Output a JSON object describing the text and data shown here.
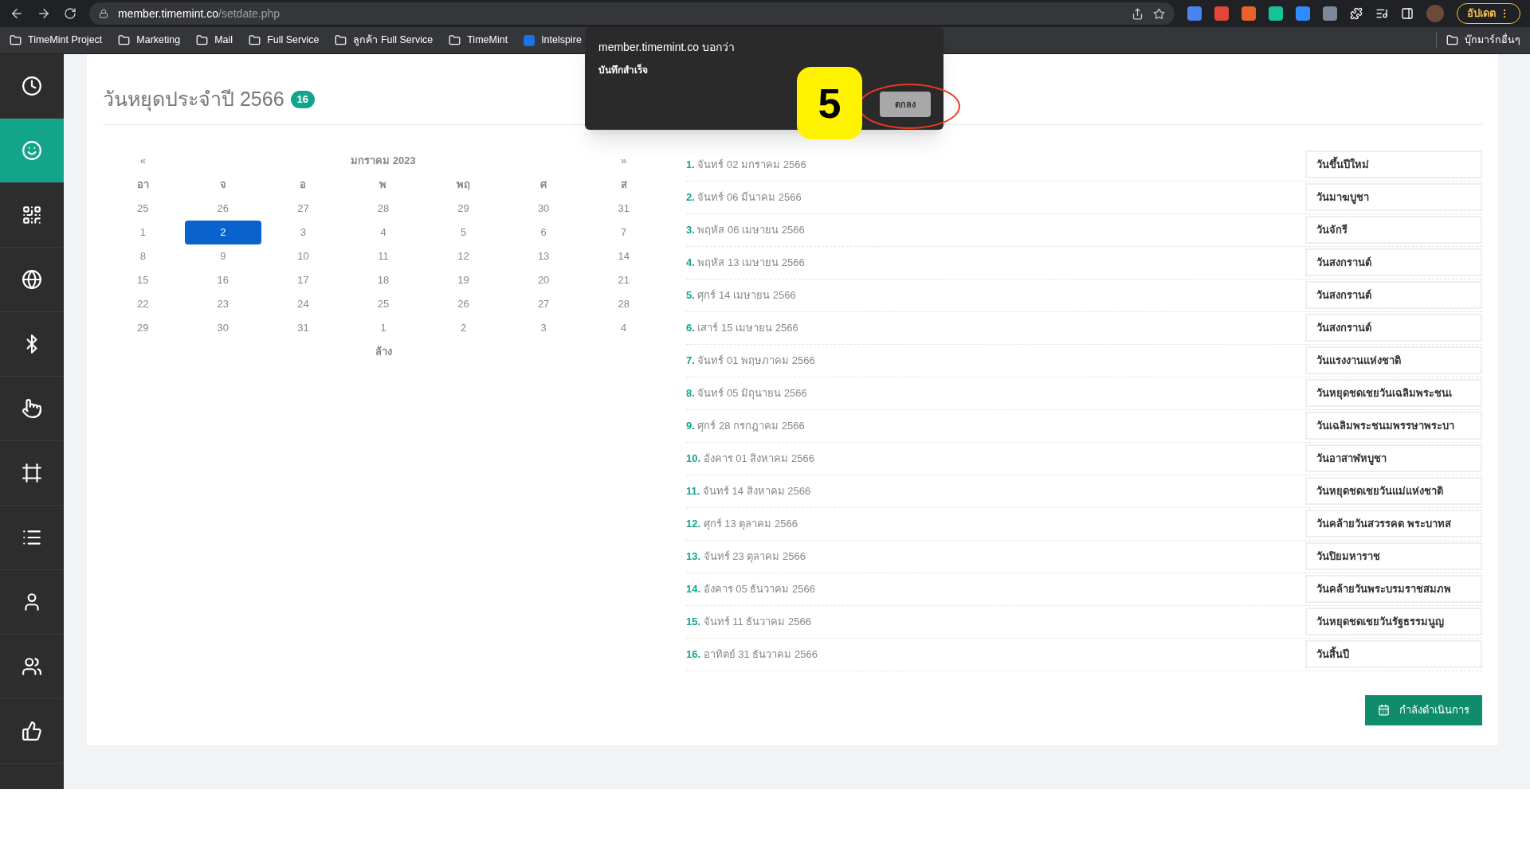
{
  "browser": {
    "url_host": "member.timemint.co",
    "url_path": "/setdate.php",
    "update_button": "อัปเดต",
    "bookmarks": [
      "TimeMint Project",
      "Marketing",
      "Mail",
      "Full Service",
      "ลูกค้า Full Service",
      "TimeMint",
      "Intelspire"
    ],
    "other_bookmarks": "บุ๊กมาร์กอื่นๆ"
  },
  "sidebar": {
    "items": [
      {
        "selected": false
      },
      {
        "selected": true
      },
      {
        "selected": false
      },
      {
        "selected": false
      },
      {
        "selected": false
      },
      {
        "selected": false
      },
      {
        "selected": false
      },
      {
        "selected": false
      },
      {
        "selected": false
      },
      {
        "selected": false
      },
      {
        "selected": false
      }
    ]
  },
  "page": {
    "title": "วันหยุดประจำปี 2566",
    "count": "16"
  },
  "calendar": {
    "prev": "«",
    "next": "»",
    "month_label": "มกราคม 2023",
    "weekdays": [
      "อา",
      "จ",
      "อ",
      "พ",
      "พฤ",
      "ศ",
      "ส"
    ],
    "weeks": [
      [
        {
          "day": "25",
          "selected": false
        },
        {
          "day": "26",
          "selected": false
        },
        {
          "day": "27",
          "selected": false
        },
        {
          "day": "28",
          "selected": false
        },
        {
          "day": "29",
          "selected": false
        },
        {
          "day": "30",
          "selected": false
        },
        {
          "day": "31",
          "selected": false
        }
      ],
      [
        {
          "day": "1",
          "selected": false
        },
        {
          "day": "2",
          "selected": true
        },
        {
          "day": "3",
          "selected": false
        },
        {
          "day": "4",
          "selected": false
        },
        {
          "day": "5",
          "selected": false
        },
        {
          "day": "6",
          "selected": false
        },
        {
          "day": "7",
          "selected": false
        }
      ],
      [
        {
          "day": "8",
          "selected": false
        },
        {
          "day": "9",
          "selected": false
        },
        {
          "day": "10",
          "selected": false
        },
        {
          "day": "11",
          "selected": false
        },
        {
          "day": "12",
          "selected": false
        },
        {
          "day": "13",
          "selected": false
        },
        {
          "day": "14",
          "selected": false
        }
      ],
      [
        {
          "day": "15",
          "selected": false
        },
        {
          "day": "16",
          "selected": false
        },
        {
          "day": "17",
          "selected": false
        },
        {
          "day": "18",
          "selected": false
        },
        {
          "day": "19",
          "selected": false
        },
        {
          "day": "20",
          "selected": false
        },
        {
          "day": "21",
          "selected": false
        }
      ],
      [
        {
          "day": "22",
          "selected": false
        },
        {
          "day": "23",
          "selected": false
        },
        {
          "day": "24",
          "selected": false
        },
        {
          "day": "25",
          "selected": false
        },
        {
          "day": "26",
          "selected": false
        },
        {
          "day": "27",
          "selected": false
        },
        {
          "day": "28",
          "selected": false
        }
      ],
      [
        {
          "day": "29",
          "selected": false
        },
        {
          "day": "30",
          "selected": false
        },
        {
          "day": "31",
          "selected": false
        },
        {
          "day": "1",
          "selected": false
        },
        {
          "day": "2",
          "selected": false
        },
        {
          "day": "3",
          "selected": false
        },
        {
          "day": "4",
          "selected": false
        }
      ]
    ],
    "clear": "ล้าง"
  },
  "holidays": [
    {
      "number": "1.",
      "date": "จันทร์ 02 มกราคม 2566",
      "name": "วันขึ้นปีใหม่"
    },
    {
      "number": "2.",
      "date": "จันทร์ 06 มีนาคม 2566",
      "name": "วันมาฆบูชา"
    },
    {
      "number": "3.",
      "date": "พฤหัส 06 เมษายน 2566",
      "name": "วันจักรี"
    },
    {
      "number": "4.",
      "date": "พฤหัส 13 เมษายน 2566",
      "name": "วันสงกรานต์"
    },
    {
      "number": "5.",
      "date": "ศุกร์ 14 เมษายน 2566",
      "name": "วันสงกรานต์"
    },
    {
      "number": "6.",
      "date": "เสาร์ 15 เมษายน 2566",
      "name": "วันสงกรานต์"
    },
    {
      "number": "7.",
      "date": "จันทร์ 01 พฤษภาคม 2566",
      "name": "วันแรงงานแห่งชาติ"
    },
    {
      "number": "8.",
      "date": "จันทร์ 05 มิถุนายน 2566",
      "name": "วันหยุดชดเชยวันเฉลิมพระชนเ"
    },
    {
      "number": "9.",
      "date": "ศุกร์ 28 กรกฎาคม 2566",
      "name": "วันเฉลิมพระชนมพรรษาพระบา"
    },
    {
      "number": "10.",
      "date": "อังคาร 01 สิงหาคม 2566",
      "name": "วันอาสาฬหบูชา"
    },
    {
      "number": "11.",
      "date": "จันทร์ 14 สิงหาคม 2566",
      "name": "วันหยุดชดเชยวันแม่แห่งชาติ"
    },
    {
      "number": "12.",
      "date": "ศุกร์ 13 ตุลาคม 2566",
      "name": "วันคล้ายวันสวรรคต พระบาทส"
    },
    {
      "number": "13.",
      "date": "จันทร์ 23 ตุลาคม 2566",
      "name": "วันปิยมหาราช"
    },
    {
      "number": "14.",
      "date": "อังคาร 05 ธันวาคม 2566",
      "name": "วันคล้ายวันพระบรมราชสมภพ"
    },
    {
      "number": "15.",
      "date": "จันทร์ 11 ธันวาคม 2566",
      "name": "วันหยุดชดเชยวันรัฐธรรมนูญ"
    },
    {
      "number": "16.",
      "date": "อาทิตย์ 31 ธันวาคม 2566",
      "name": "วันสิ้นปี"
    }
  ],
  "submit_button": "กำลังดำเนินการ",
  "dialog": {
    "origin": "member.timemint.co บอกว่า",
    "message": "บันทึกสำเร็จ",
    "ok_button": "ตกลง"
  },
  "annotation": {
    "step": "5"
  }
}
